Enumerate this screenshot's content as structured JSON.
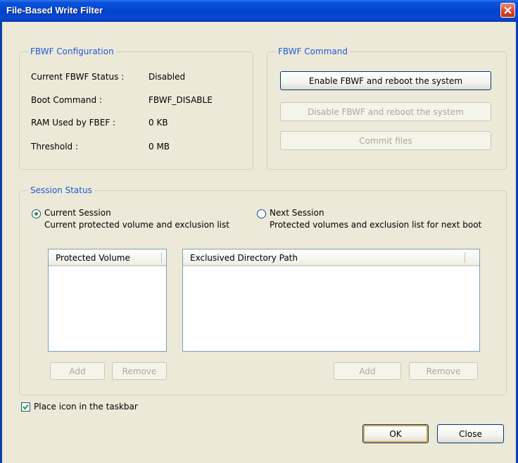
{
  "window": {
    "title": "File-Based Write Filter"
  },
  "config": {
    "legend": "FBWF Configuration",
    "rows": [
      {
        "label": "Current FBWF Status :",
        "value": "Disabled"
      },
      {
        "label": "Boot Command :",
        "value": "FBWF_DISABLE"
      },
      {
        "label": "RAM Used by FBEF :",
        "value": "0 KB"
      },
      {
        "label": "Threshold :",
        "value": "0 MB"
      }
    ]
  },
  "command": {
    "legend": "FBWF Command",
    "enable_label": "Enable FBWF and reboot the system",
    "disable_label": "Disable FBWF and reboot the system",
    "commit_label": "Commit files"
  },
  "session": {
    "legend": "Session Status",
    "current": {
      "title": "Current Session",
      "desc": "Current  protected volume and exclusion list",
      "selected": true
    },
    "next": {
      "title": "Next Session",
      "desc": "Protected volumes and exclusion list for next boot",
      "selected": false
    },
    "protected_header": "Protected Volume",
    "exclusion_header": "Exclusived Directory Path",
    "add_label": "Add",
    "remove_label": "Remove"
  },
  "taskbar": {
    "label": "Place icon in the taskbar",
    "checked": true
  },
  "footer": {
    "ok_label": "OK",
    "close_label": "Close"
  }
}
